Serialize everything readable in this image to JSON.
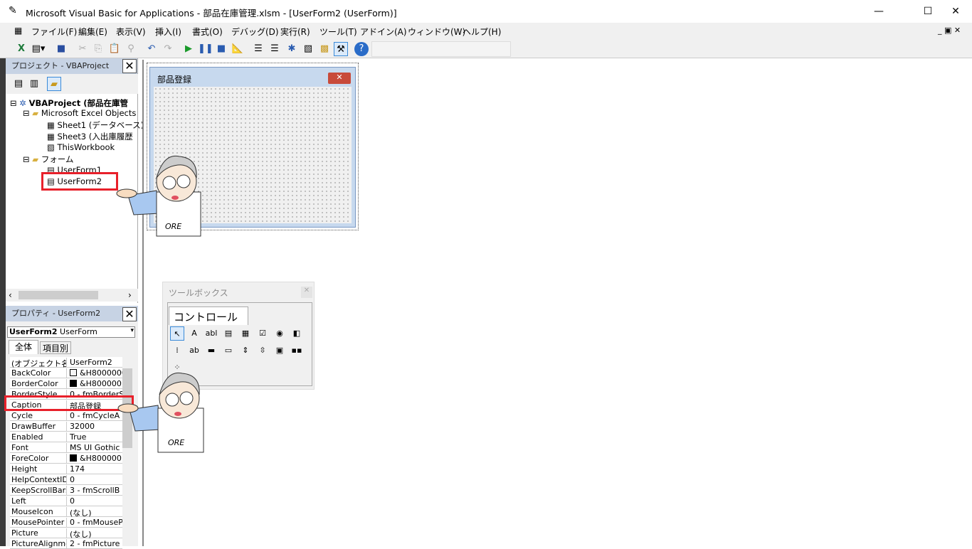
{
  "window": {
    "title": "Microsoft Visual Basic for Applications - 部品在庫管理.xlsm - [UserForm2 (UserForm)]",
    "minimize": "—",
    "maximize": "☐",
    "close": "✕"
  },
  "menu": [
    "ファイル(F)",
    "編集(E)",
    "表示(V)",
    "挿入(I)",
    "書式(O)",
    "デバッグ(D)",
    "実行(R)",
    "ツール(T)",
    "アドイン(A)",
    "ウィンドウ(W)",
    "ヘルプ(H)"
  ],
  "toolbar_icons": [
    "excel-icon",
    "insert-userform-icon",
    "save-icon",
    "cut-icon",
    "copy-icon",
    "paste-icon",
    "find-icon",
    "undo-icon",
    "redo-icon",
    "run-icon",
    "pause-icon",
    "reset-icon",
    "design-mode-icon",
    "project-explorer-icon",
    "properties-icon",
    "object-browser-icon",
    "toolbox-icon",
    "help-icon"
  ],
  "project": {
    "title": "プロジェクト - VBAProject",
    "root": "VBAProject (部品在庫管",
    "excel_objects": "Microsoft Excel Objects",
    "sheets": [
      "Sheet1 (データベース)",
      "Sheet3 (入出庫履歴",
      "ThisWorkbook"
    ],
    "forms_folder": "フォーム",
    "forms": [
      "UserForm1",
      "UserForm2"
    ]
  },
  "properties": {
    "title": "プロパティ - UserForm2",
    "object_name": "UserForm2",
    "object_type": "UserForm",
    "tabs": [
      "全体",
      "項目別"
    ],
    "rows": [
      [
        "(オブジェクト名)",
        "UserForm2"
      ],
      [
        "BackColor",
        "&H8000000"
      ],
      [
        "BorderColor",
        "&H8000001"
      ],
      [
        "BorderStyle",
        "0 - fmBorderS"
      ],
      [
        "Caption",
        "部品登録"
      ],
      [
        "Cycle",
        "0 - fmCycleA"
      ],
      [
        "DrawBuffer",
        "32000"
      ],
      [
        "Enabled",
        "True"
      ],
      [
        "Font",
        "MS UI Gothic"
      ],
      [
        "ForeColor",
        "&H8000001"
      ],
      [
        "Height",
        "174"
      ],
      [
        "HelpContextID",
        "0"
      ],
      [
        "KeepScrollBars",
        "3 - fmScrollB"
      ],
      [
        "Left",
        "0"
      ],
      [
        "MouseIcon",
        "(なし)"
      ],
      [
        "MousePointer",
        "0 - fmMouseP"
      ],
      [
        "Picture",
        "(なし)"
      ],
      [
        "PictureAlignment",
        "2 - fmPicture"
      ]
    ]
  },
  "form": {
    "caption": "部品登録"
  },
  "toolbox": {
    "title": "ツールボックス",
    "tab": "コントロール",
    "tools": [
      "↖",
      "A",
      "abl",
      "▤",
      "▦",
      "☑",
      "◉",
      "◧",
      "⁞",
      "ab",
      "▬",
      "▭",
      "⇕",
      "⇳",
      "▣",
      "▪▪",
      "⁘"
    ]
  },
  "annotation": {
    "signature": "ORE"
  }
}
